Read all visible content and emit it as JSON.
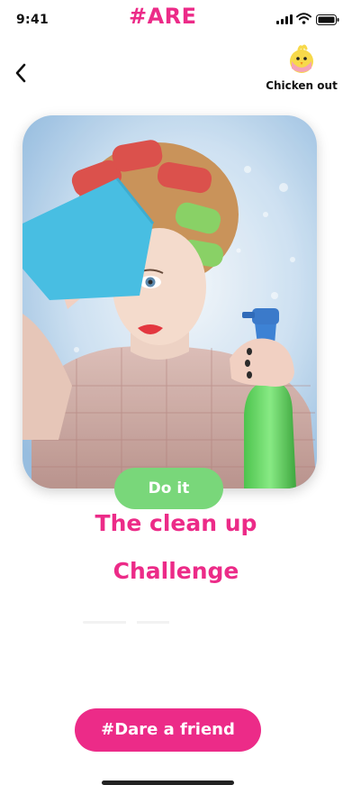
{
  "status_bar": {
    "time": "9:41",
    "logo": "#ARE"
  },
  "header": {
    "chicken_out_label": "Chicken out"
  },
  "card": {
    "image_alt": "Woman in hair curlers cleaning glass with a spray bottle"
  },
  "actions": {
    "do_it_label": "Do it",
    "dare_friend_label": "#Dare a friend"
  },
  "challenge": {
    "title_line1": "The clean up",
    "title_line2": "Challenge"
  },
  "colors": {
    "brand_pink": "#ec2b88",
    "accent_green": "#79d77a"
  }
}
